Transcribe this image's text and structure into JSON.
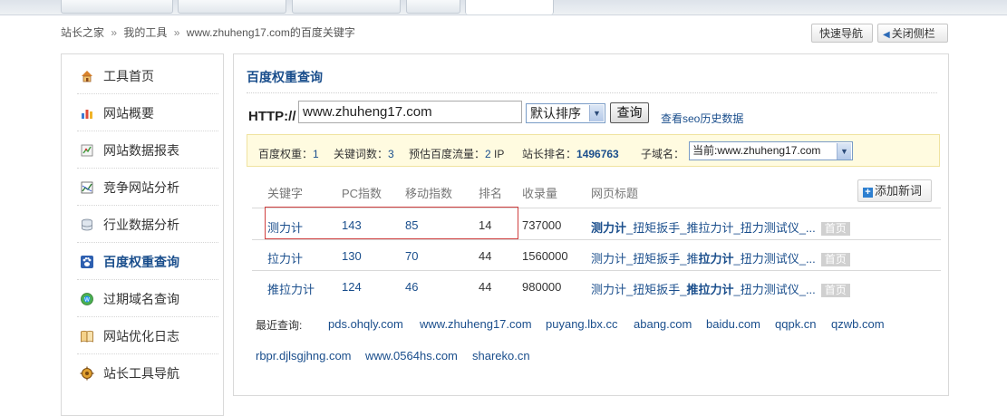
{
  "breadcrumb": {
    "home": "站长之家",
    "tools": "我的工具",
    "current": "www.zhuheng17.com的百度关键字"
  },
  "top_buttons": {
    "quick_nav": "快速导航",
    "close_sidebar": "关闭侧栏"
  },
  "sidebar": {
    "items": [
      {
        "label": "工具首页",
        "icon": "home-icon"
      },
      {
        "label": "网站概要",
        "icon": "bar-chart-icon"
      },
      {
        "label": "网站数据报表",
        "icon": "report-icon"
      },
      {
        "label": "竞争网站分析",
        "icon": "line-chart-icon"
      },
      {
        "label": "行业数据分析",
        "icon": "database-icon"
      },
      {
        "label": "百度权重查询",
        "icon": "baidu-paw-icon",
        "active": true
      },
      {
        "label": "过期域名查询",
        "icon": "globe-icon"
      },
      {
        "label": "网站优化日志",
        "icon": "book-icon"
      },
      {
        "label": "站长工具导航",
        "icon": "compass-icon"
      }
    ]
  },
  "panel": {
    "title": "百度权重查询",
    "http_label": "HTTP://",
    "url_value": "www.zhuheng17.com",
    "sort_value": "默认排序",
    "query_button": "查询",
    "seo_history_link": "查看seo历史数据"
  },
  "info": {
    "weight_label": "百度权重：",
    "weight_value": "1",
    "keywords_label": "关键词数：",
    "keywords_value": "3",
    "traffic_label": "预估百度流量：",
    "traffic_value": "2",
    "traffic_unit": "IP",
    "rank_label": "站长排名：",
    "rank_value": "1496763",
    "subdomain_label": "子域名：",
    "subdomain_value": "当前:www.zhuheng17.com"
  },
  "table": {
    "headers": [
      "关键字",
      "PC指数",
      "移动指数",
      "排名",
      "收录量",
      "网页标题"
    ],
    "add_button": "添加新词",
    "home_badge": "首页",
    "rows": [
      {
        "keyword": "测力计",
        "pc": "143",
        "mobile": "85",
        "rank": "14",
        "indexed": "737000",
        "title_pre": "",
        "title_bold": "测力计",
        "title_post": "_扭矩扳手_推拉力计_扭力测试仪_..."
      },
      {
        "keyword": "拉力计",
        "pc": "130",
        "mobile": "70",
        "rank": "44",
        "indexed": "1560000",
        "title_pre": "测力计_扭矩扳手_推",
        "title_bold": "拉力计",
        "title_post": "_扭力测试仪_..."
      },
      {
        "keyword": "推拉力计",
        "pc": "124",
        "mobile": "46",
        "rank": "44",
        "indexed": "980000",
        "title_pre": "测力计_扭矩扳手_",
        "title_bold": "推拉力计",
        "title_post": "_扭力测试仪_..."
      }
    ]
  },
  "recent": {
    "label": "最近查询:",
    "links": [
      "pds.ohqly.com",
      "www.zhuheng17.com",
      "puyang.lbx.cc",
      "abang.com",
      "baidu.com",
      "qqpk.cn",
      "qzwb.com",
      "rbpr.djlsgjhng.com",
      "www.0564hs.com",
      "shareko.cn"
    ]
  }
}
